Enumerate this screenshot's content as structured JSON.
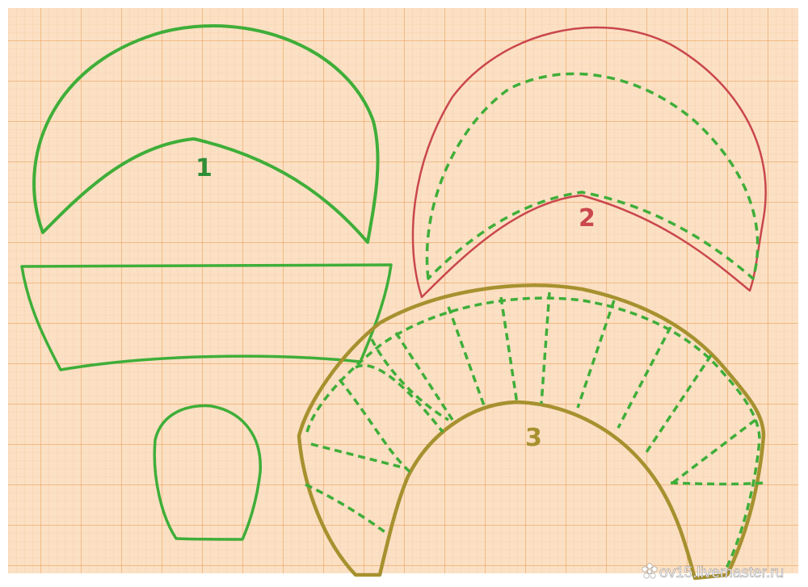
{
  "pattern_labels": {
    "piece_1": "1",
    "piece_2": "2",
    "piece_3": "3"
  },
  "watermark": {
    "text": "ov15.livemaster.ru",
    "icon": "flower-icon"
  },
  "colors": {
    "paper": "#fbe0c4",
    "grid_minor": "#f4c28f",
    "grid_major": "#ec9a52",
    "green_line": "#3fae39",
    "red_line": "#c9474d",
    "olive_line": "#a6912f",
    "label_1": "#2e8f38",
    "label_2": "#c9474d",
    "label_3": "#a6912f"
  }
}
